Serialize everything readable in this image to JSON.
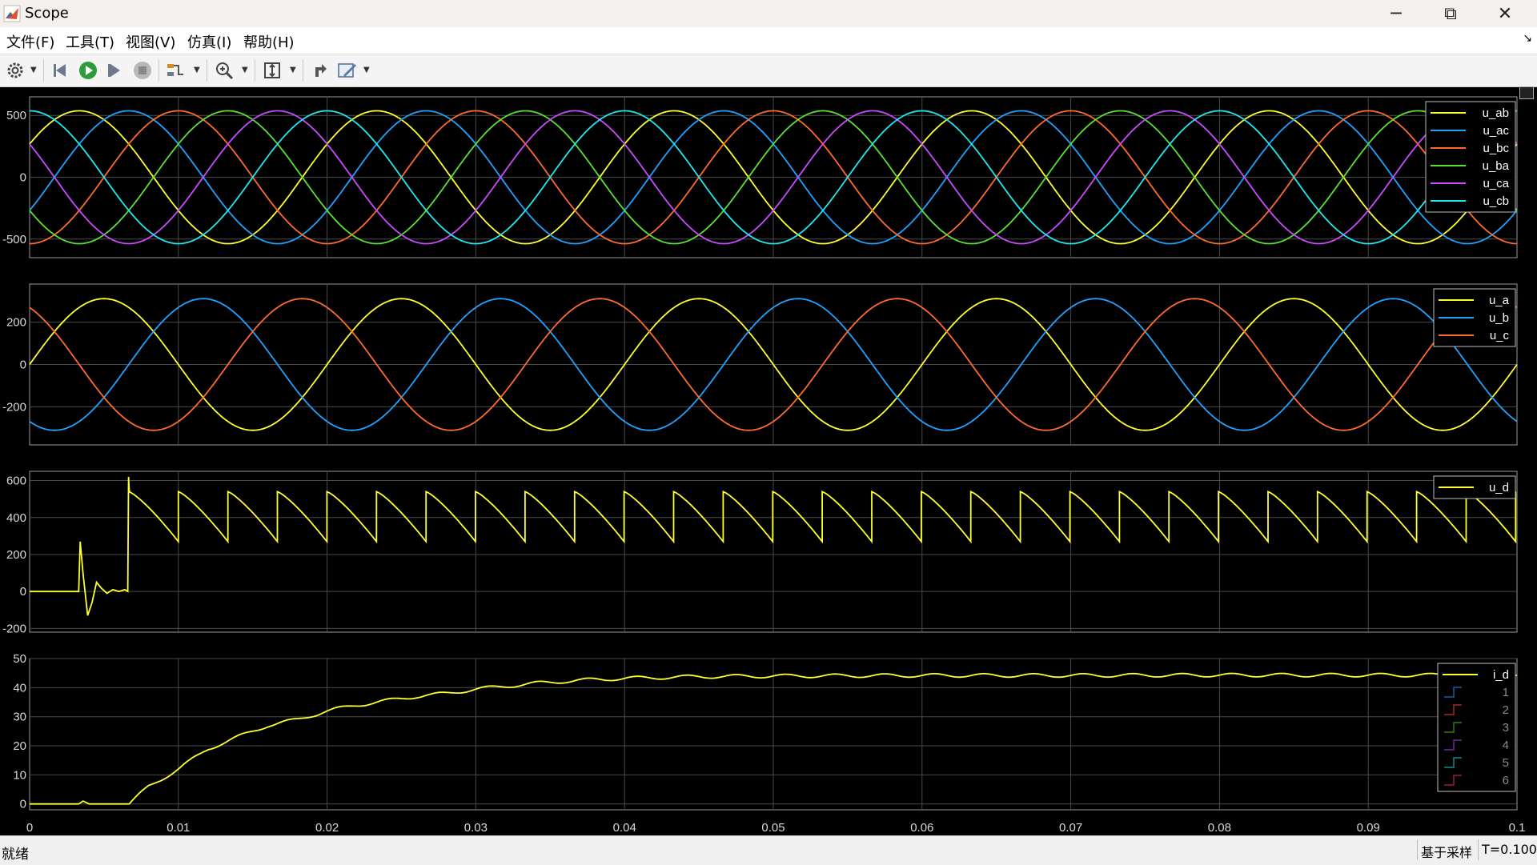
{
  "window": {
    "title": "Scope",
    "app_icon": "matlab-logo-icon"
  },
  "window_controls": {
    "minimize": "─",
    "restore": "⧉",
    "close": "✕"
  },
  "menu": [
    {
      "label": "文件(F)"
    },
    {
      "label": "工具(T)"
    },
    {
      "label": "视图(V)"
    },
    {
      "label": "仿真(I)"
    },
    {
      "label": "帮助(H)"
    }
  ],
  "toolbar": {
    "icons": [
      "settings-gear-icon",
      "step-back-icon",
      "run-icon",
      "step-forward-icon",
      "stop-icon",
      "signal-trigger-icon",
      "zoom-in-icon",
      "autoscale-icon",
      "highlight-block-icon",
      "measure-pen-icon"
    ]
  },
  "plots": [
    {
      "id": "line-voltage",
      "yticks": [
        "500",
        "0",
        "-500"
      ],
      "legend": [
        "u_ab",
        "u_ac",
        "u_bc",
        "u_ba",
        "u_ca",
        "u_cb"
      ]
    },
    {
      "id": "phase-voltage",
      "yticks": [
        "200",
        "0",
        "-200"
      ],
      "legend": [
        "u_a",
        "u_b",
        "u_c"
      ]
    },
    {
      "id": "dc-voltage",
      "yticks": [
        "600",
        "400",
        "200",
        "0",
        "-200"
      ],
      "legend": [
        "u_d"
      ]
    },
    {
      "id": "dc-current",
      "yticks": [
        "50",
        "40",
        "30",
        "20",
        "10",
        "0"
      ],
      "legend": [
        "i_d",
        "1",
        "2",
        "3",
        "4",
        "5",
        "6"
      ]
    }
  ],
  "xticks": [
    "0",
    "0.01",
    "0.02",
    "0.03",
    "0.04",
    "0.05",
    "0.06",
    "0.07",
    "0.08",
    "0.09",
    "0.1"
  ],
  "colors": {
    "yellow": "#ffff2e",
    "blue": "#1fa2ff",
    "orange": "#ff6a2e",
    "green": "#5be034",
    "purple": "#c84bff",
    "cyan": "#1ee9ee",
    "dark_blue": "#1a5ea0",
    "dark_red": "#a02a22",
    "dark_green": "#2f7a1a",
    "dark_purple": "#6a2aa0",
    "dark_cyan": "#128a8c",
    "dark_crimson": "#a01a44"
  },
  "chart_data": [
    {
      "type": "line",
      "xlim": [
        0,
        0.1
      ],
      "ylim": [
        -650,
        650
      ],
      "grid": true,
      "legend_position": "top-right",
      "series": [
        {
          "name": "u_ab",
          "waveform": "sine",
          "amplitude": 537,
          "frequency_hz": 50,
          "phase_deg": 30,
          "color": "#ffff2e"
        },
        {
          "name": "u_ac",
          "waveform": "sine",
          "amplitude": 537,
          "frequency_hz": 50,
          "phase_deg": -30,
          "color": "#1fa2ff"
        },
        {
          "name": "u_bc",
          "waveform": "sine",
          "amplitude": 537,
          "frequency_hz": 50,
          "phase_deg": -90,
          "color": "#ff6a2e"
        },
        {
          "name": "u_ba",
          "waveform": "sine",
          "amplitude": 537,
          "frequency_hz": 50,
          "phase_deg": -150,
          "color": "#5be034"
        },
        {
          "name": "u_ca",
          "waveform": "sine",
          "amplitude": 537,
          "frequency_hz": 50,
          "phase_deg": 150,
          "color": "#c84bff"
        },
        {
          "name": "u_cb",
          "waveform": "sine",
          "amplitude": 537,
          "frequency_hz": 50,
          "phase_deg": 90,
          "color": "#1ee9ee"
        }
      ]
    },
    {
      "type": "line",
      "xlim": [
        0,
        0.1
      ],
      "ylim": [
        -380,
        380
      ],
      "grid": true,
      "legend_position": "top-right",
      "series": [
        {
          "name": "u_a",
          "waveform": "sine",
          "amplitude": 311,
          "frequency_hz": 50,
          "phase_deg": 0,
          "color": "#ffff2e"
        },
        {
          "name": "u_b",
          "waveform": "sine",
          "amplitude": 311,
          "frequency_hz": 50,
          "phase_deg": -120,
          "color": "#1fa2ff"
        },
        {
          "name": "u_c",
          "waveform": "sine",
          "amplitude": 311,
          "frequency_hz": 50,
          "phase_deg": 120,
          "color": "#ff6a2e"
        }
      ]
    },
    {
      "type": "line",
      "xlim": [
        0,
        0.1
      ],
      "ylim": [
        -220,
        650
      ],
      "grid": true,
      "legend_position": "top-right",
      "series": [
        {
          "name": "u_d",
          "color": "#ffff2e",
          "waveform": "rectified-sawtooth",
          "x": [
            0,
            0.0033,
            0.0034,
            0.0036,
            0.0039,
            0.0042,
            0.0045,
            0.0048,
            0.0052,
            0.0056,
            0.006,
            0.0064,
            0.0066,
            0.00665,
            0.0067,
            0.0068
          ],
          "y": [
            0,
            0,
            270,
            90,
            -130,
            -60,
            50,
            20,
            -10,
            10,
            0,
            10,
            0,
            620,
            540,
            540
          ],
          "period_start_s": 0.00667,
          "period_s": 0.00333,
          "period_peak": 540,
          "period_trough": 270
        }
      ]
    },
    {
      "type": "line",
      "xlim": [
        0,
        0.1
      ],
      "ylim": [
        -2,
        50
      ],
      "grid": true,
      "legend_position": "top-right",
      "series": [
        {
          "name": "i_d",
          "color": "#ffff2e",
          "x": [
            0,
            0.0033,
            0.0036,
            0.004,
            0.0045,
            0.0067,
            0.008,
            0.01,
            0.012,
            0.014,
            0.016,
            0.018,
            0.02,
            0.022,
            0.024,
            0.026,
            0.028,
            0.03,
            0.032,
            0.034,
            0.036,
            0.038,
            0.04,
            0.045,
            0.05,
            0.06,
            0.07,
            0.08,
            0.09,
            0.1
          ],
          "y": [
            0,
            0,
            1,
            0,
            0,
            0,
            6,
            12,
            19,
            23,
            27,
            29,
            32,
            34,
            35.5,
            37,
            38,
            39.5,
            40.5,
            41.5,
            42.2,
            42.8,
            43.2,
            43.8,
            44,
            44.2,
            44.2,
            44.3,
            44.3,
            44.3
          ],
          "ripple_amplitude": 1
        },
        {
          "name": "1",
          "color": "#1a5ea0",
          "values": []
        },
        {
          "name": "2",
          "color": "#a02a22",
          "values": []
        },
        {
          "name": "3",
          "color": "#2f7a1a",
          "values": []
        },
        {
          "name": "4",
          "color": "#6a2aa0",
          "values": []
        },
        {
          "name": "5",
          "color": "#128a8c",
          "values": []
        },
        {
          "name": "6",
          "color": "#a01a44",
          "values": []
        }
      ]
    }
  ],
  "status": {
    "ready": "就绪",
    "mode": "基于采样",
    "time": "T=0.100"
  }
}
